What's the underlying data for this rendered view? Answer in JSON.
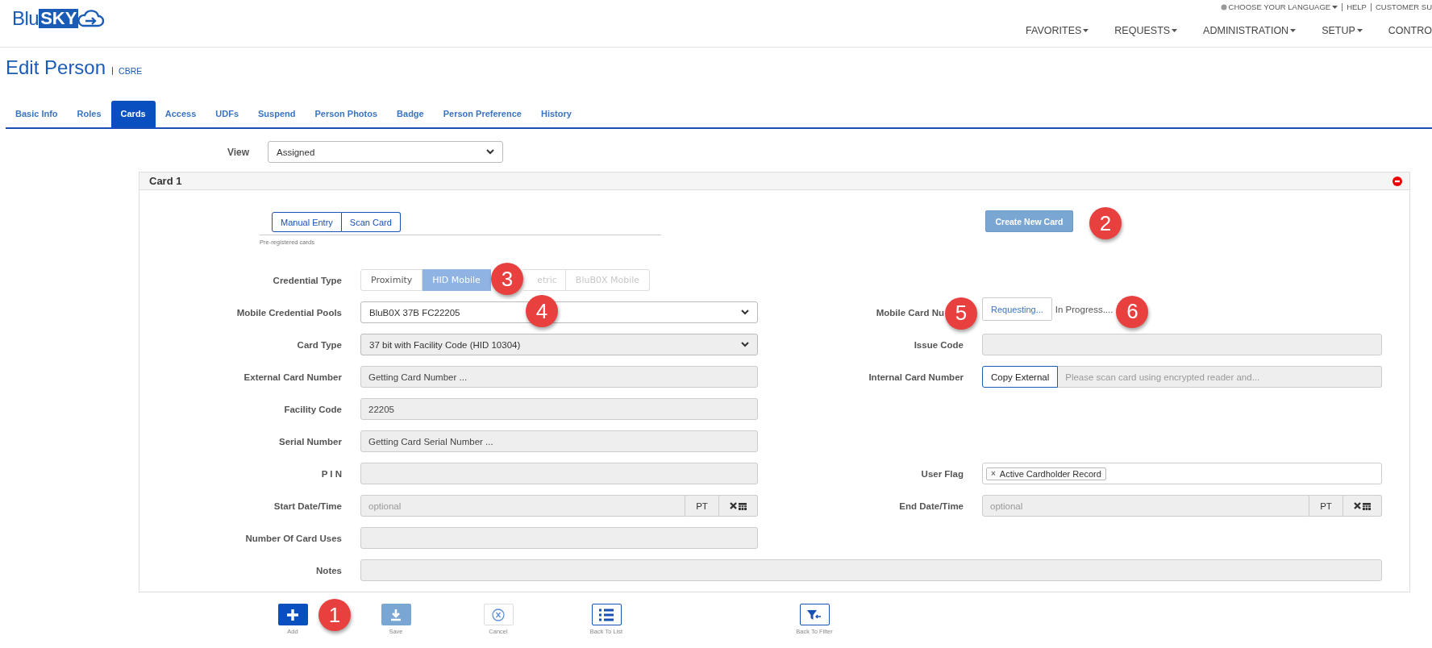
{
  "logo": {
    "prefix": "Blu",
    "highlight": "SKY"
  },
  "top_links": [
    {
      "label": "CHOOSE YOUR LANGUAGE",
      "kind": "language"
    },
    {
      "label": "HELP",
      "kind": "link"
    },
    {
      "label": "CUSTOMER SU",
      "kind": "link"
    }
  ],
  "nav": [
    {
      "label": "FAVORITES",
      "dropdown": true
    },
    {
      "label": "REQUESTS",
      "dropdown": true
    },
    {
      "label": "ADMINISTRATION",
      "dropdown": true
    },
    {
      "label": "SETUP",
      "dropdown": true
    },
    {
      "label": "CONTRO",
      "dropdown": false
    }
  ],
  "page": {
    "title": "Edit Person",
    "subtitle": "CBRE"
  },
  "tabs": [
    {
      "label": "Basic Info",
      "selected": false
    },
    {
      "label": "Roles",
      "selected": false
    },
    {
      "label": "Cards",
      "selected": true
    },
    {
      "label": "Access",
      "selected": false
    },
    {
      "label": "UDFs",
      "selected": false
    },
    {
      "label": "Suspend",
      "selected": false
    },
    {
      "label": "Person Photos",
      "selected": false
    },
    {
      "label": "Badge",
      "selected": false
    },
    {
      "label": "Person Preference",
      "selected": false
    },
    {
      "label": "History",
      "selected": false
    }
  ],
  "view": {
    "label": "View",
    "value": "Assigned"
  },
  "card": {
    "title": "Card 1",
    "entry_modes": [
      {
        "label": "Manual Entry"
      },
      {
        "label": "Scan Card"
      }
    ],
    "entry_note": "Pre-registered cards",
    "create_button": {
      "label": "Create New Card",
      "callout": "2"
    },
    "form_rows": [
      {
        "left": {
          "kind": "toggle",
          "label": "Credential Type",
          "options": [
            {
              "label": "Proximity",
              "selected": false,
              "disabled": false
            },
            {
              "label": "HID Mobile",
              "selected": true,
              "disabled": false,
              "callout": "3"
            },
            {
              "label": "etric",
              "selected": false,
              "disabled": true
            },
            {
              "label": "BluB0X Mobile",
              "selected": false,
              "disabled": true
            }
          ]
        }
      },
      {
        "left": {
          "kind": "select",
          "label": "Mobile Credential Pools",
          "value": "BluB0X 37B FC22205",
          "disabled": false,
          "callout": "4"
        },
        "right": {
          "kind": "status",
          "label": "Mobile Card Nu",
          "label_callout": "5",
          "button": "Requesting...",
          "status": "In Progress....",
          "status_callout": "6"
        }
      },
      {
        "left": {
          "kind": "select",
          "label": "Card Type",
          "value": "37 bit with Facility Code (HID 10304)",
          "disabled": true
        },
        "right": {
          "kind": "input",
          "label": "Issue Code",
          "disabled": true
        }
      },
      {
        "left": {
          "kind": "input",
          "label": "External Card Number",
          "value": "Getting Card Number ...",
          "disabled": true
        },
        "right": {
          "kind": "copy",
          "label": "Internal Card Number",
          "button": "Copy External",
          "placeholder": "Please scan card using encrypted reader and..."
        }
      },
      {
        "left": {
          "kind": "input",
          "label": "Facility Code",
          "value": "22205",
          "disabled": true
        }
      },
      {
        "left": {
          "kind": "input",
          "label": "Serial Number",
          "value": "Getting Card Serial Number ...",
          "disabled": true
        }
      },
      {
        "left": {
          "kind": "input",
          "label": "P I N",
          "disabled": true
        },
        "right": {
          "kind": "tags",
          "label": "User Flag",
          "tags": [
            {
              "label": "Active Cardholder Record",
              "remove": "×"
            }
          ]
        }
      },
      {
        "left": {
          "kind": "datetime",
          "label": "Start Date/Time",
          "placeholder": "optional",
          "timezone": "PT"
        },
        "right": {
          "kind": "datetime",
          "label": "End Date/Time",
          "placeholder": "optional",
          "timezone": "PT"
        }
      },
      {
        "left": {
          "kind": "input",
          "label": "Number Of Card Uses",
          "disabled": true
        }
      },
      {
        "left": {
          "kind": "wide",
          "label": "Notes",
          "disabled": true
        }
      }
    ]
  },
  "toolbar": [
    {
      "label": "Add",
      "kind": "add",
      "callout": "1"
    },
    {
      "label": "Save",
      "kind": "save"
    },
    {
      "label": "Cancel",
      "kind": "cancel"
    },
    {
      "label": "Back To List",
      "kind": "list"
    },
    {
      "label": "Back To Filter",
      "kind": "filter"
    }
  ]
}
